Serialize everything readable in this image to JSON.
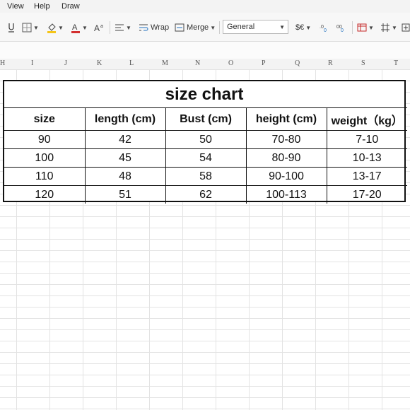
{
  "menu": {
    "view": "View",
    "help": "Help",
    "draw": "Draw"
  },
  "toolbar": {
    "wrap_label": "Wrap",
    "merge_label": "Merge",
    "number_format": "General",
    "currency_label": "$€"
  },
  "columns": [
    "H",
    "I",
    "J",
    "K",
    "L",
    "M",
    "N",
    "O",
    "P",
    "Q",
    "R",
    "S",
    "T"
  ],
  "sheet": {
    "title": "size chart",
    "headers": [
      "size",
      "length (cm)",
      "Bust (cm)",
      "height (cm)",
      "weight（kg）"
    ],
    "rows": [
      [
        "90",
        "42",
        "50",
        "70-80",
        "7-10"
      ],
      [
        "100",
        "45",
        "54",
        "80-90",
        "10-13"
      ],
      [
        "110",
        "48",
        "58",
        "90-100",
        "13-17"
      ],
      [
        "120",
        "51",
        "62",
        "100-113",
        "17-20"
      ]
    ]
  },
  "colors": {
    "font_color_bar": "#d32f2f",
    "fill_color_bar": "#f5c518",
    "accent": "#1f6fbf"
  }
}
